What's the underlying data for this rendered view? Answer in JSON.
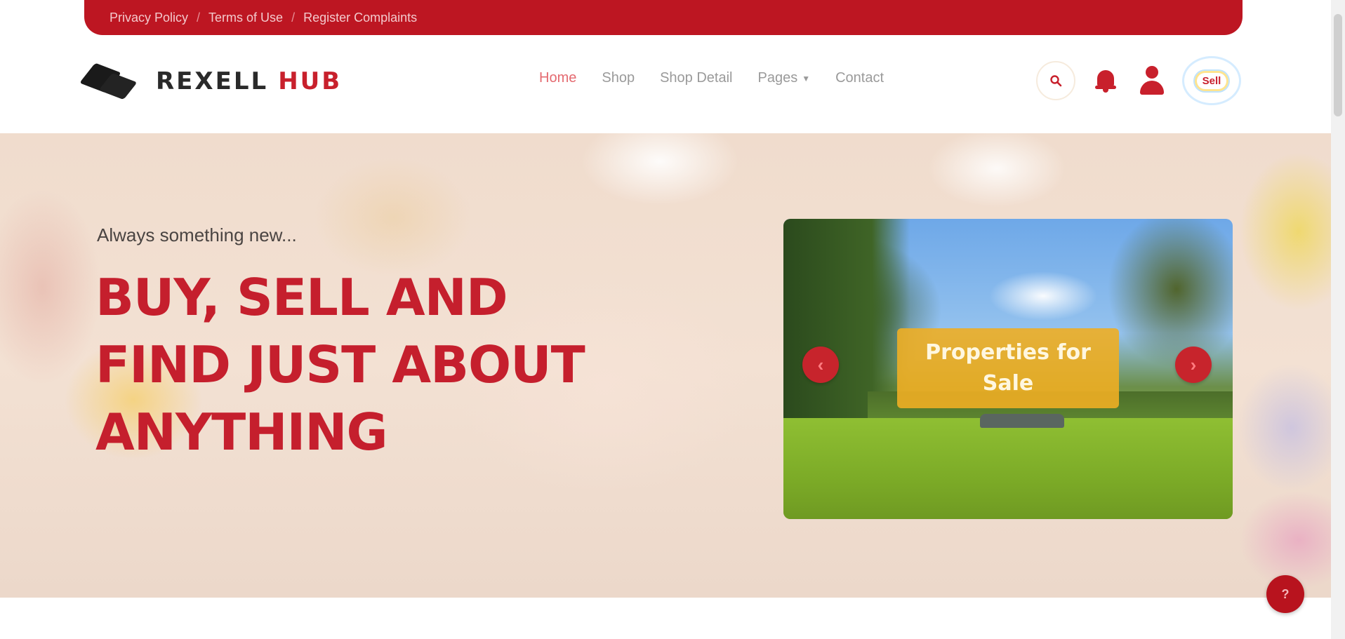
{
  "topbar": {
    "links": [
      "Privacy Policy",
      "Terms of Use",
      "Register Complaints"
    ],
    "separator": "/"
  },
  "header": {
    "logo": {
      "brand": "REXELL",
      "suffix": "HUB"
    },
    "nav": [
      {
        "label": "Home",
        "active": true
      },
      {
        "label": "Shop",
        "active": false
      },
      {
        "label": "Shop Detail",
        "active": false
      },
      {
        "label": "Pages",
        "active": false,
        "has_dropdown": true
      },
      {
        "label": "Contact",
        "active": false
      }
    ],
    "icons": {
      "search": "search-icon",
      "notifications": "bell-icon",
      "account": "user-icon"
    },
    "sell_label": "Sell"
  },
  "hero": {
    "tagline": "Always something new...",
    "headline_lines": [
      "BUY, SELL AND",
      "FIND JUST ABOUT",
      "ANYTHING"
    ],
    "slide": {
      "caption": "Properties for Sale"
    },
    "prev_glyph": "‹",
    "next_glyph": "›"
  },
  "chat_glyph": "?",
  "colors": {
    "brand_red": "#bd1622",
    "headline_red": "#c51f2d",
    "banner_amber": "#eeae24",
    "nav_active": "#e46a70"
  }
}
